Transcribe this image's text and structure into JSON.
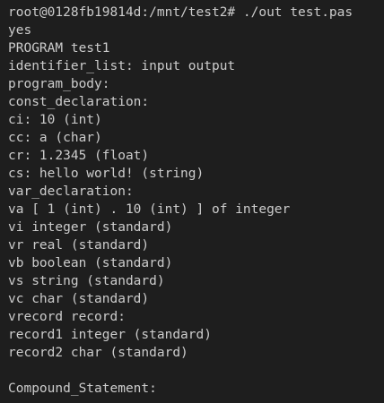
{
  "terminal": {
    "lines": [
      "root@0128fb19814d:/mnt/test2# ./out test.pas",
      "yes",
      "PROGRAM test1",
      "identifier_list: input output",
      "program_body:",
      "const_declaration:",
      "ci: 10 (int)",
      "cc: a (char)",
      "cr: 1.2345 (float)",
      "cs: hello world! (string)",
      "var_declaration:",
      "va [ 1 (int) . 10 (int) ] of integer",
      "vi integer (standard)",
      "vr real (standard)",
      "vb boolean (standard)",
      "vs string (standard)",
      "vc char (standard)",
      "vrecord record:",
      "record1 integer (standard)",
      "record2 char (standard)",
      "",
      "Compound_Statement:"
    ],
    "colors": {
      "background": "#1e1e1e",
      "foreground": "#cccccc"
    }
  }
}
